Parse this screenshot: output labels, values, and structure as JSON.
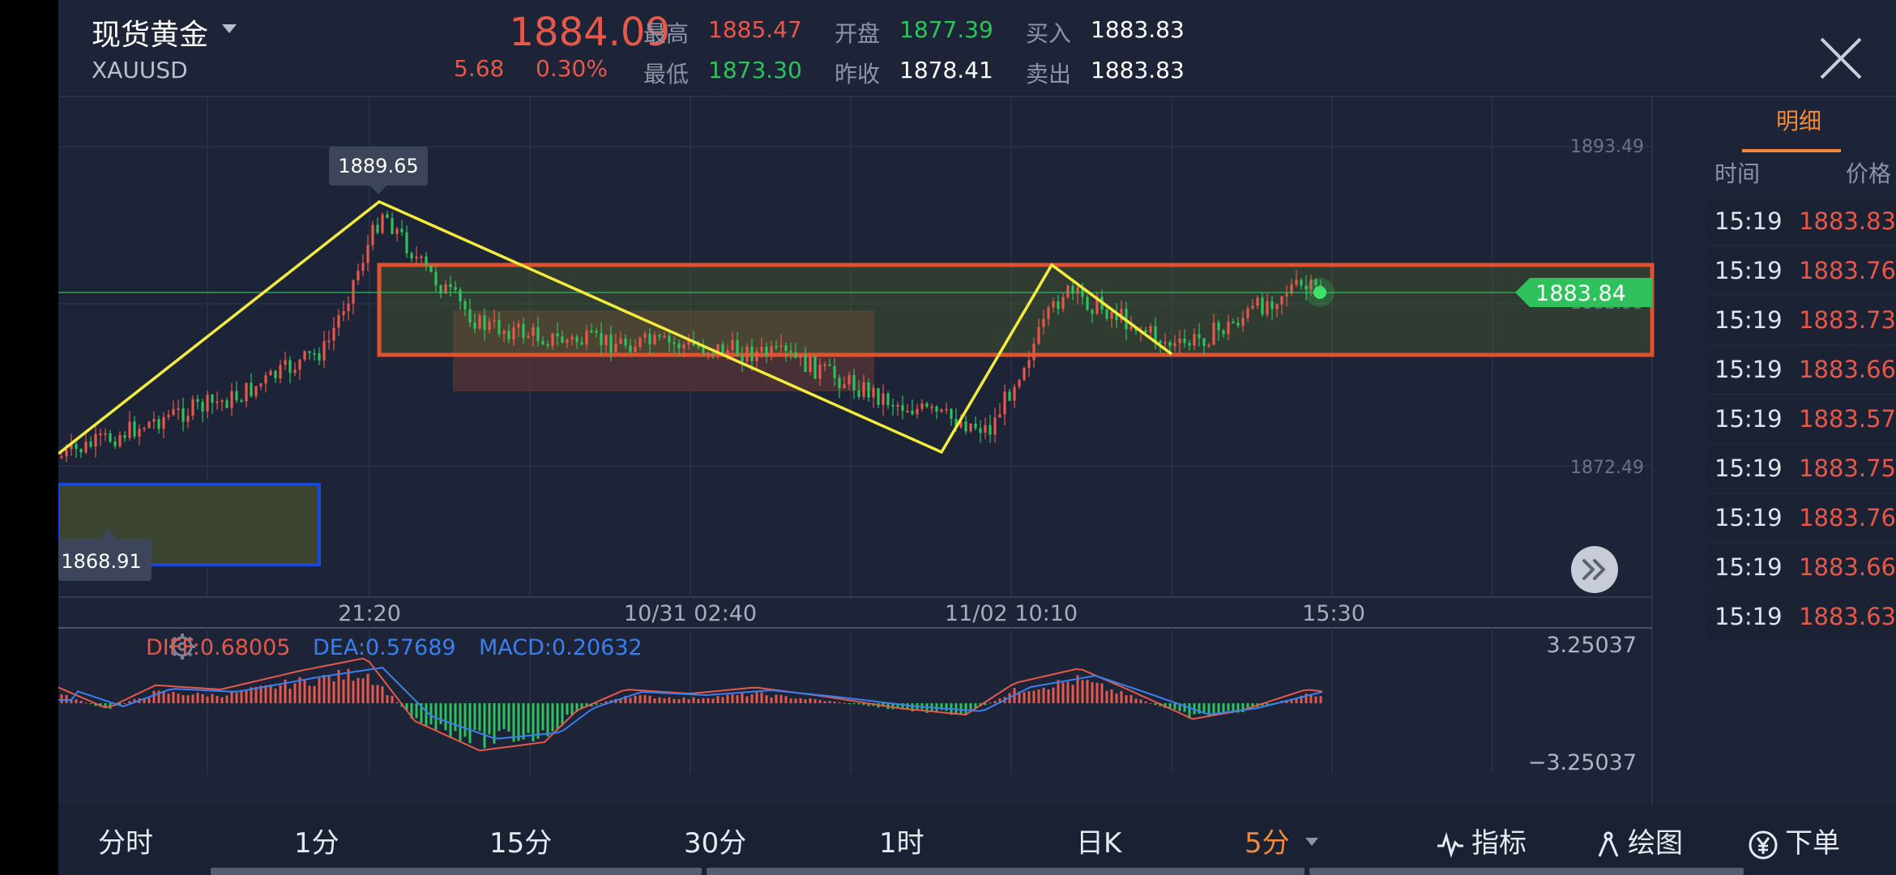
{
  "header": {
    "title": "现货黄金",
    "symbol": "XAUUSD",
    "price": "1884.09",
    "change": "5.68",
    "change_pct": "0.30%",
    "quotes": [
      {
        "label": "最高",
        "value": "1885.47",
        "color": "red"
      },
      {
        "label": "最低",
        "value": "1873.30",
        "color": "green"
      },
      {
        "label": "开盘",
        "value": "1877.39",
        "color": "green"
      },
      {
        "label": "昨收",
        "value": "1878.41",
        "color": "white"
      },
      {
        "label": "买入",
        "value": "1883.83",
        "color": "white"
      },
      {
        "label": "卖出",
        "value": "1883.83",
        "color": "white"
      }
    ]
  },
  "chart": {
    "price_axis": [
      "1893.49",
      "1872.49"
    ],
    "hidden_axis_label": "1882.99",
    "high_label": "1889.65",
    "low_label": "1868.91",
    "current_price_tag": "1883.84",
    "time_axis": [
      "21:20",
      "10/31 02:40",
      "11/02 10:10",
      "15:30"
    ]
  },
  "macd": {
    "diff_label": "DIFF:0.68005",
    "dea_label": "DEA:0.57689",
    "macd_label": "MACD:0.20632",
    "axis_max": "3.25037",
    "axis_min": "−3.25037"
  },
  "panel": {
    "tab": "明细",
    "col_time": "时间",
    "col_price": "价格",
    "rows": [
      {
        "time": "15:19",
        "price": "1883.83"
      },
      {
        "time": "15:19",
        "price": "1883.76"
      },
      {
        "time": "15:19",
        "price": "1883.73"
      },
      {
        "time": "15:19",
        "price": "1883.66"
      },
      {
        "time": "15:19",
        "price": "1883.57"
      },
      {
        "time": "15:19",
        "price": "1883.75"
      },
      {
        "time": "15:19",
        "price": "1883.76"
      },
      {
        "time": "15:19",
        "price": "1883.66"
      },
      {
        "time": "15:19",
        "price": "1883.63"
      }
    ]
  },
  "timeframes": [
    "分时",
    "1分",
    "15分",
    "30分",
    "1时",
    "日K",
    "5分"
  ],
  "active_timeframe": "5分",
  "tools": {
    "indicator": "指标",
    "draw": "绘图",
    "order": "下单"
  },
  "colors": {
    "up": "#e5584a",
    "down": "#2fc25c",
    "accent": "#f08a3a",
    "trendline": "#f3ec3c",
    "zone": "#e0512f"
  }
}
